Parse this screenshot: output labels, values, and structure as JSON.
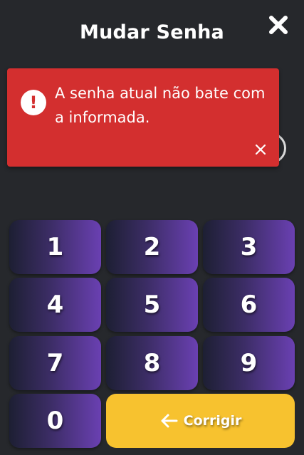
{
  "header": {
    "title": "Mudar Senha",
    "close_icon": "close-icon"
  },
  "pin": {
    "dots_count": 6
  },
  "toast": {
    "icon": "error-icon",
    "icon_glyph": "!",
    "message": "A senha atual não bate com a informada.",
    "close_icon": "close-icon",
    "color": "#d32f2f"
  },
  "keypad": {
    "keys": [
      "1",
      "2",
      "3",
      "4",
      "5",
      "6",
      "7",
      "8",
      "9",
      "0"
    ],
    "correct_label": "Corrigir",
    "correct_icon": "arrow-left-icon",
    "correct_color": "#f7c22f"
  }
}
